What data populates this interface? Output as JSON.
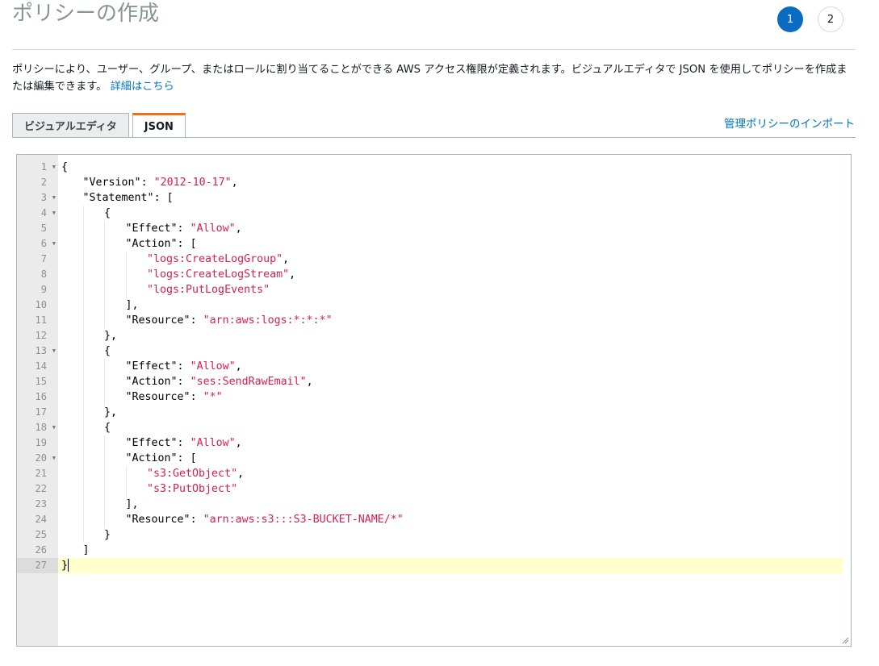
{
  "page": {
    "title": "ポリシーの作成",
    "steps": [
      "1",
      "2"
    ],
    "description": "ポリシーにより、ユーザー、グループ、またはロールに割り当てることができる AWS アクセス権限が定義されます。ビジュアルエディタで JSON を使用してポリシーを作成または編集できます。",
    "description_link": "詳細はこちら"
  },
  "tabs": [
    {
      "label": "ビジュアルエディタ",
      "active": false
    },
    {
      "label": "JSON",
      "active": true
    }
  ],
  "import_link": "管理ポリシーのインポート",
  "editor": {
    "current_line": 27,
    "lines": [
      {
        "n": "1",
        "fold": true,
        "indent": 0,
        "text": "{"
      },
      {
        "n": "2",
        "fold": false,
        "indent": 1,
        "key": "\"Version\"",
        "sep": ": ",
        "val": "\"2012-10-17\"",
        "tail": ","
      },
      {
        "n": "3",
        "fold": true,
        "indent": 1,
        "key": "\"Statement\"",
        "sep": ": ",
        "tail": "["
      },
      {
        "n": "4",
        "fold": true,
        "indent": 2,
        "text": "{"
      },
      {
        "n": "5",
        "fold": false,
        "indent": 3,
        "key": "\"Effect\"",
        "sep": ": ",
        "val": "\"Allow\"",
        "tail": ","
      },
      {
        "n": "6",
        "fold": true,
        "indent": 3,
        "key": "\"Action\"",
        "sep": ": ",
        "tail": "["
      },
      {
        "n": "7",
        "fold": false,
        "indent": 4,
        "val": "\"logs:CreateLogGroup\"",
        "tail": ","
      },
      {
        "n": "8",
        "fold": false,
        "indent": 4,
        "val": "\"logs:CreateLogStream\"",
        "tail": ","
      },
      {
        "n": "9",
        "fold": false,
        "indent": 4,
        "val": "\"logs:PutLogEvents\""
      },
      {
        "n": "10",
        "fold": false,
        "indent": 3,
        "text": "],"
      },
      {
        "n": "11",
        "fold": false,
        "indent": 3,
        "key": "\"Resource\"",
        "sep": ": ",
        "val": "\"arn:aws:logs:*:*:*\""
      },
      {
        "n": "12",
        "fold": false,
        "indent": 2,
        "text": "},"
      },
      {
        "n": "13",
        "fold": true,
        "indent": 2,
        "text": "{"
      },
      {
        "n": "14",
        "fold": false,
        "indent": 3,
        "key": "\"Effect\"",
        "sep": ": ",
        "val": "\"Allow\"",
        "tail": ","
      },
      {
        "n": "15",
        "fold": false,
        "indent": 3,
        "key": "\"Action\"",
        "sep": ": ",
        "val": "\"ses:SendRawEmail\"",
        "tail": ","
      },
      {
        "n": "16",
        "fold": false,
        "indent": 3,
        "key": "\"Resource\"",
        "sep": ": ",
        "val": "\"*\""
      },
      {
        "n": "17",
        "fold": false,
        "indent": 2,
        "text": "},"
      },
      {
        "n": "18",
        "fold": true,
        "indent": 2,
        "text": "{"
      },
      {
        "n": "19",
        "fold": false,
        "indent": 3,
        "key": "\"Effect\"",
        "sep": ": ",
        "val": "\"Allow\"",
        "tail": ","
      },
      {
        "n": "20",
        "fold": true,
        "indent": 3,
        "key": "\"Action\"",
        "sep": ": ",
        "tail": "["
      },
      {
        "n": "21",
        "fold": false,
        "indent": 4,
        "val": "\"s3:GetObject\"",
        "tail": ","
      },
      {
        "n": "22",
        "fold": false,
        "indent": 4,
        "val": "\"s3:PutObject\""
      },
      {
        "n": "23",
        "fold": false,
        "indent": 3,
        "text": "],"
      },
      {
        "n": "24",
        "fold": false,
        "indent": 3,
        "key": "\"Resource\"",
        "sep": ": ",
        "val": "\"arn:aws:s3:::S3-BUCKET-NAME/*\""
      },
      {
        "n": "25",
        "fold": false,
        "indent": 2,
        "text": "}"
      },
      {
        "n": "26",
        "fold": false,
        "indent": 1,
        "text": "]"
      },
      {
        "n": "27",
        "fold": false,
        "indent": 0,
        "text": "}"
      }
    ]
  },
  "colors": {
    "accent": "#0a6bc2",
    "link": "#0073bb",
    "tab_active_top": "#ec7211",
    "string": "#d6204e",
    "current_line": "#ffffcc"
  }
}
